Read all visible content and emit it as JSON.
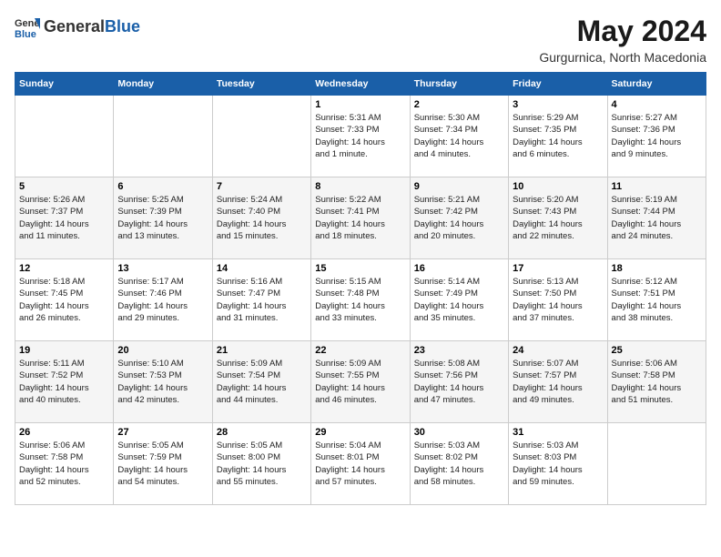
{
  "header": {
    "logo_general": "General",
    "logo_blue": "Blue",
    "title": "May 2024",
    "subtitle": "Gurgurnica, North Macedonia"
  },
  "days_of_week": [
    "Sunday",
    "Monday",
    "Tuesday",
    "Wednesday",
    "Thursday",
    "Friday",
    "Saturday"
  ],
  "weeks": [
    [
      {
        "day": "",
        "info": ""
      },
      {
        "day": "",
        "info": ""
      },
      {
        "day": "",
        "info": ""
      },
      {
        "day": "1",
        "info": "Sunrise: 5:31 AM\nSunset: 7:33 PM\nDaylight: 14 hours\nand 1 minute."
      },
      {
        "day": "2",
        "info": "Sunrise: 5:30 AM\nSunset: 7:34 PM\nDaylight: 14 hours\nand 4 minutes."
      },
      {
        "day": "3",
        "info": "Sunrise: 5:29 AM\nSunset: 7:35 PM\nDaylight: 14 hours\nand 6 minutes."
      },
      {
        "day": "4",
        "info": "Sunrise: 5:27 AM\nSunset: 7:36 PM\nDaylight: 14 hours\nand 9 minutes."
      }
    ],
    [
      {
        "day": "5",
        "info": "Sunrise: 5:26 AM\nSunset: 7:37 PM\nDaylight: 14 hours\nand 11 minutes."
      },
      {
        "day": "6",
        "info": "Sunrise: 5:25 AM\nSunset: 7:39 PM\nDaylight: 14 hours\nand 13 minutes."
      },
      {
        "day": "7",
        "info": "Sunrise: 5:24 AM\nSunset: 7:40 PM\nDaylight: 14 hours\nand 15 minutes."
      },
      {
        "day": "8",
        "info": "Sunrise: 5:22 AM\nSunset: 7:41 PM\nDaylight: 14 hours\nand 18 minutes."
      },
      {
        "day": "9",
        "info": "Sunrise: 5:21 AM\nSunset: 7:42 PM\nDaylight: 14 hours\nand 20 minutes."
      },
      {
        "day": "10",
        "info": "Sunrise: 5:20 AM\nSunset: 7:43 PM\nDaylight: 14 hours\nand 22 minutes."
      },
      {
        "day": "11",
        "info": "Sunrise: 5:19 AM\nSunset: 7:44 PM\nDaylight: 14 hours\nand 24 minutes."
      }
    ],
    [
      {
        "day": "12",
        "info": "Sunrise: 5:18 AM\nSunset: 7:45 PM\nDaylight: 14 hours\nand 26 minutes."
      },
      {
        "day": "13",
        "info": "Sunrise: 5:17 AM\nSunset: 7:46 PM\nDaylight: 14 hours\nand 29 minutes."
      },
      {
        "day": "14",
        "info": "Sunrise: 5:16 AM\nSunset: 7:47 PM\nDaylight: 14 hours\nand 31 minutes."
      },
      {
        "day": "15",
        "info": "Sunrise: 5:15 AM\nSunset: 7:48 PM\nDaylight: 14 hours\nand 33 minutes."
      },
      {
        "day": "16",
        "info": "Sunrise: 5:14 AM\nSunset: 7:49 PM\nDaylight: 14 hours\nand 35 minutes."
      },
      {
        "day": "17",
        "info": "Sunrise: 5:13 AM\nSunset: 7:50 PM\nDaylight: 14 hours\nand 37 minutes."
      },
      {
        "day": "18",
        "info": "Sunrise: 5:12 AM\nSunset: 7:51 PM\nDaylight: 14 hours\nand 38 minutes."
      }
    ],
    [
      {
        "day": "19",
        "info": "Sunrise: 5:11 AM\nSunset: 7:52 PM\nDaylight: 14 hours\nand 40 minutes."
      },
      {
        "day": "20",
        "info": "Sunrise: 5:10 AM\nSunset: 7:53 PM\nDaylight: 14 hours\nand 42 minutes."
      },
      {
        "day": "21",
        "info": "Sunrise: 5:09 AM\nSunset: 7:54 PM\nDaylight: 14 hours\nand 44 minutes."
      },
      {
        "day": "22",
        "info": "Sunrise: 5:09 AM\nSunset: 7:55 PM\nDaylight: 14 hours\nand 46 minutes."
      },
      {
        "day": "23",
        "info": "Sunrise: 5:08 AM\nSunset: 7:56 PM\nDaylight: 14 hours\nand 47 minutes."
      },
      {
        "day": "24",
        "info": "Sunrise: 5:07 AM\nSunset: 7:57 PM\nDaylight: 14 hours\nand 49 minutes."
      },
      {
        "day": "25",
        "info": "Sunrise: 5:06 AM\nSunset: 7:58 PM\nDaylight: 14 hours\nand 51 minutes."
      }
    ],
    [
      {
        "day": "26",
        "info": "Sunrise: 5:06 AM\nSunset: 7:58 PM\nDaylight: 14 hours\nand 52 minutes."
      },
      {
        "day": "27",
        "info": "Sunrise: 5:05 AM\nSunset: 7:59 PM\nDaylight: 14 hours\nand 54 minutes."
      },
      {
        "day": "28",
        "info": "Sunrise: 5:05 AM\nSunset: 8:00 PM\nDaylight: 14 hours\nand 55 minutes."
      },
      {
        "day": "29",
        "info": "Sunrise: 5:04 AM\nSunset: 8:01 PM\nDaylight: 14 hours\nand 57 minutes."
      },
      {
        "day": "30",
        "info": "Sunrise: 5:03 AM\nSunset: 8:02 PM\nDaylight: 14 hours\nand 58 minutes."
      },
      {
        "day": "31",
        "info": "Sunrise: 5:03 AM\nSunset: 8:03 PM\nDaylight: 14 hours\nand 59 minutes."
      },
      {
        "day": "",
        "info": ""
      }
    ]
  ]
}
